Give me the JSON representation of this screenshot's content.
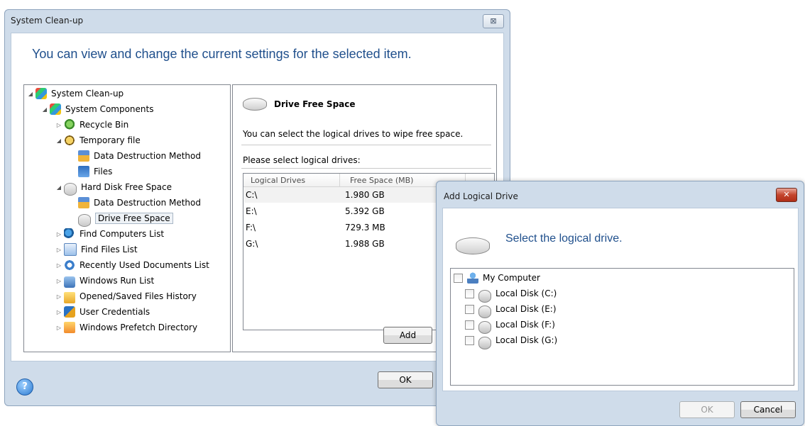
{
  "main_dialog": {
    "title": "System Clean-up",
    "close_icon": "close-icon",
    "headline": "You can view and change the current settings for the selected item.",
    "tree": [
      {
        "label": "System Clean-up",
        "icon": "flag-icon",
        "expander": "◢"
      },
      {
        "label": "System Components",
        "icon": "flag-icon",
        "expander": "◢"
      },
      {
        "label": "Recycle Bin",
        "icon": "recycle-bin-icon",
        "expander": "▷"
      },
      {
        "label": "Temporary file",
        "icon": "temporary-file-icon",
        "expander": "◢"
      },
      {
        "label": "Data Destruction Method",
        "icon": "shredder-icon",
        "expander": ""
      },
      {
        "label": "Files",
        "icon": "files-icon",
        "expander": ""
      },
      {
        "label": "Hard Disk Free Space",
        "icon": "disk-icon",
        "expander": "◢"
      },
      {
        "label": "Data Destruction Method",
        "icon": "shredder-icon",
        "expander": ""
      },
      {
        "label": "Drive Free Space",
        "icon": "disk-icon",
        "expander": ""
      },
      {
        "label": "Find Computers List",
        "icon": "find-computers-icon",
        "expander": "▷"
      },
      {
        "label": "Find Files List",
        "icon": "find-files-icon",
        "expander": "▷"
      },
      {
        "label": "Recently Used Documents List",
        "icon": "recent-documents-icon",
        "expander": "▷"
      },
      {
        "label": "Windows Run List",
        "icon": "run-icon",
        "expander": "▷"
      },
      {
        "label": "Opened/Saved Files History",
        "icon": "folder-icon",
        "expander": "▷"
      },
      {
        "label": "User Credentials",
        "icon": "user-credentials-icon",
        "expander": "▷"
      },
      {
        "label": "Windows Prefetch Directory",
        "icon": "prefetch-icon",
        "expander": "▷"
      }
    ],
    "right_panel": {
      "heading": "Drive Free Space",
      "description": "You can select the logical drives to wipe free space.",
      "prompt": "Please select logical drives:",
      "columns": [
        "Logical Drives",
        "Free Space (MB)"
      ],
      "rows": [
        {
          "drive": "C:\\",
          "free": "1.980 GB"
        },
        {
          "drive": "E:\\",
          "free": "5.392 GB"
        },
        {
          "drive": "F:\\",
          "free": "729.3 MB"
        },
        {
          "drive": "G:\\",
          "free": "1.988 GB"
        }
      ],
      "add_button": "Add"
    },
    "ok_button": "OK",
    "help_icon": "help-icon",
    "help_glyph": "?"
  },
  "add_dialog": {
    "title": "Add Logical Drive",
    "close_glyph": "✕",
    "heading": "Select the logical drive.",
    "root": "My Computer",
    "disks": [
      "Local Disk (C:)",
      "Local Disk (E:)",
      "Local Disk (F:)",
      "Local Disk (G:)"
    ],
    "ok_button": "OK",
    "cancel_button": "Cancel"
  }
}
